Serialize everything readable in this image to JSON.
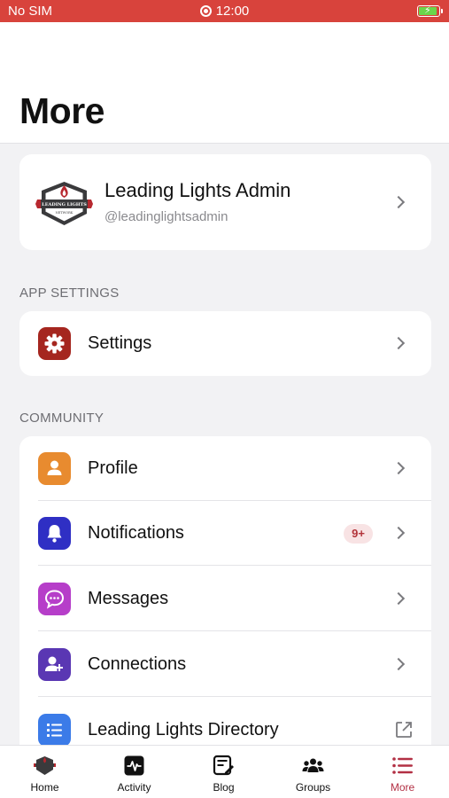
{
  "status_bar": {
    "carrier": "No SIM",
    "time": "12:00"
  },
  "header": {
    "title": "More"
  },
  "account": {
    "name": "Leading Lights Admin",
    "handle": "@leadinglightsadmin",
    "logo_text": "LEADING LIGHTS NETWORK"
  },
  "sections": {
    "app_settings": {
      "label": "APP SETTINGS",
      "items": [
        {
          "label": "Settings",
          "icon": "gear-icon",
          "color": "#a5261f"
        }
      ]
    },
    "community": {
      "label": "COMMUNITY",
      "items": [
        {
          "label": "Profile",
          "icon": "person-icon",
          "color": "#e88b2f"
        },
        {
          "label": "Notifications",
          "icon": "bell-icon",
          "color": "#2f2fc4",
          "badge": "9+"
        },
        {
          "label": "Messages",
          "icon": "chat-bubble-icon",
          "color": "#b63ec9"
        },
        {
          "label": "Connections",
          "icon": "add-person-icon",
          "color": "#5a37b3"
        },
        {
          "label": "Leading Lights Directory",
          "icon": "list-icon",
          "color": "#3b7be8",
          "external": true
        }
      ]
    }
  },
  "tab_bar": {
    "items": [
      {
        "label": "Home",
        "icon": "home-logo-icon"
      },
      {
        "label": "Activity",
        "icon": "activity-icon"
      },
      {
        "label": "Blog",
        "icon": "blog-icon"
      },
      {
        "label": "Groups",
        "icon": "groups-icon"
      },
      {
        "label": "More",
        "icon": "menu-icon",
        "active": true
      }
    ]
  },
  "colors": {
    "status_bar": "#d8433c",
    "accent": "#b23044",
    "background": "#f2f2f4"
  }
}
